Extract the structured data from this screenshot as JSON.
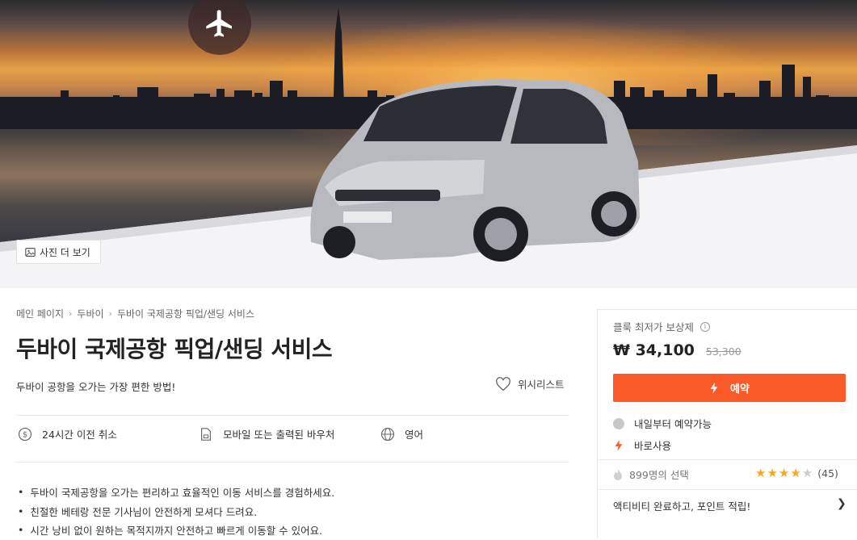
{
  "hero": {
    "photo_button_label": "사진 더 보기"
  },
  "breadcrumb": [
    "메인 페이지",
    "두바이",
    "두바이 국제공항 픽업/샌딩 서비스"
  ],
  "product": {
    "title": "두바이 국제공항 픽업/샌딩 서비스",
    "subtitle": "두바이 공항을 오가는 가장 편한 방법!",
    "wishlist_label": "위시리스트",
    "features": [
      {
        "icon": "dollar-coin-icon",
        "label": "24시간 이전 취소"
      },
      {
        "icon": "mobile-voucher-icon",
        "label": "모바일 또는 출력된 바우처"
      },
      {
        "icon": "globe-icon",
        "label": "영어"
      }
    ],
    "highlights": [
      "두바이 국제공항을 오가는 편리하고 효율적인 이동 서비스를 경험하세요.",
      "친절한 베테랑 전문 기사님이 안전하게 모셔다 드려요.",
      "시간 낭비 없이 원하는 목적지까지 안전하고 빠르게 이동할 수 있어요."
    ]
  },
  "booking": {
    "guarantee_label": "클룩 최저가 보상제",
    "price": "₩ 34,100",
    "original_price": "53,300",
    "book_button_label": "예약",
    "availability": "내일부터 예약가능",
    "instant": "바로사용",
    "popularity": "899명의 선택",
    "rating_stars": 4,
    "rating_count": "(45)",
    "points_label": "액티비티 완료하고, 포인트 적립!",
    "accent_color": "#fa5a28",
    "star_color": "#f5a623"
  }
}
